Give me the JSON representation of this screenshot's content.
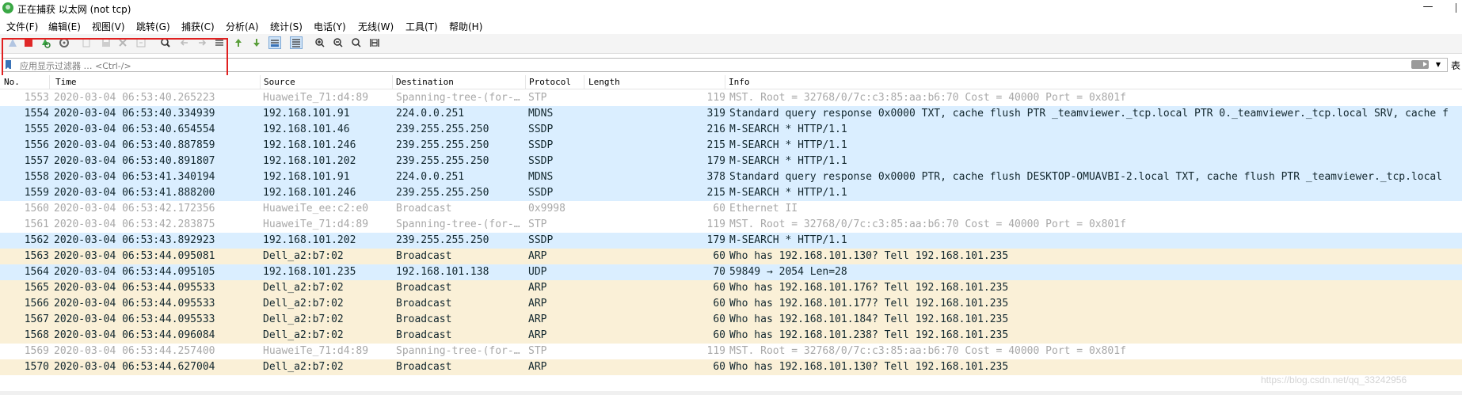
{
  "window": {
    "title": "正在捕获 以太网 (not tcp)",
    "minimize_glyph": "—"
  },
  "menu": [
    "文件(F)",
    "编辑(E)",
    "视图(V)",
    "跳转(G)",
    "捕获(C)",
    "分析(A)",
    "统计(S)",
    "电话(Y)",
    "无线(W)",
    "工具(T)",
    "帮助(H)"
  ],
  "toolbar": {
    "icons": [
      "start-capture-icon",
      "stop-capture-icon",
      "restart-capture-icon",
      "capture-options-icon",
      "open-file-icon",
      "save-file-icon",
      "close-file-icon",
      "reload-file-icon",
      "find-packet-icon",
      "go-back-icon",
      "go-forward-icon",
      "go-to-packet-icon",
      "go-first-icon",
      "go-last-icon",
      "auto-scroll-icon",
      "colorize-icon",
      "zoom-in-icon",
      "zoom-out-icon",
      "normal-size-icon",
      "resize-columns-icon"
    ]
  },
  "filter": {
    "placeholder": "应用显示过滤器 … <Ctrl-/>",
    "right_label": "表"
  },
  "columns": [
    "No.",
    "Time",
    "Source",
    "Destination",
    "Protocol",
    "Length",
    "Info"
  ],
  "packets": [
    {
      "no": "1553",
      "time": "2020-03-04 06:53:40.265223",
      "src": "HuaweiTe_71:d4:89",
      "dst": "Spanning-tree-(for-…",
      "proto": "STP",
      "len": "119",
      "info": "MST. Root = 32768/0/7c:c3:85:aa:b6:70  Cost = 40000  Port = 0x801f",
      "color": "white"
    },
    {
      "no": "1554",
      "time": "2020-03-04 06:53:40.334939",
      "src": "192.168.101.91",
      "dst": "224.0.0.251",
      "proto": "MDNS",
      "len": "319",
      "info": "Standard query response 0x0000 TXT, cache flush PTR _teamviewer._tcp.local PTR 0._teamviewer._tcp.local SRV, cache f",
      "color": "blue"
    },
    {
      "no": "1555",
      "time": "2020-03-04 06:53:40.654554",
      "src": "192.168.101.46",
      "dst": "239.255.255.250",
      "proto": "SSDP",
      "len": "216",
      "info": "M-SEARCH * HTTP/1.1",
      "color": "blue"
    },
    {
      "no": "1556",
      "time": "2020-03-04 06:53:40.887859",
      "src": "192.168.101.246",
      "dst": "239.255.255.250",
      "proto": "SSDP",
      "len": "215",
      "info": "M-SEARCH * HTTP/1.1",
      "color": "blue"
    },
    {
      "no": "1557",
      "time": "2020-03-04 06:53:40.891807",
      "src": "192.168.101.202",
      "dst": "239.255.255.250",
      "proto": "SSDP",
      "len": "179",
      "info": "M-SEARCH * HTTP/1.1",
      "color": "blue"
    },
    {
      "no": "1558",
      "time": "2020-03-04 06:53:41.340194",
      "src": "192.168.101.91",
      "dst": "224.0.0.251",
      "proto": "MDNS",
      "len": "378",
      "info": "Standard query response 0x0000 PTR, cache flush DESKTOP-OMUAVBI-2.local TXT, cache flush PTR _teamviewer._tcp.local",
      "color": "blue"
    },
    {
      "no": "1559",
      "time": "2020-03-04 06:53:41.888200",
      "src": "192.168.101.246",
      "dst": "239.255.255.250",
      "proto": "SSDP",
      "len": "215",
      "info": "M-SEARCH * HTTP/1.1",
      "color": "blue"
    },
    {
      "no": "1560",
      "time": "2020-03-04 06:53:42.172356",
      "src": "HuaweiTe_ee:c2:e0",
      "dst": "Broadcast",
      "proto": "0x9998",
      "len": "60",
      "info": "Ethernet II",
      "color": "white"
    },
    {
      "no": "1561",
      "time": "2020-03-04 06:53:42.283875",
      "src": "HuaweiTe_71:d4:89",
      "dst": "Spanning-tree-(for-…",
      "proto": "STP",
      "len": "119",
      "info": "MST. Root = 32768/0/7c:c3:85:aa:b6:70  Cost = 40000  Port = 0x801f",
      "color": "white"
    },
    {
      "no": "1562",
      "time": "2020-03-04 06:53:43.892923",
      "src": "192.168.101.202",
      "dst": "239.255.255.250",
      "proto": "SSDP",
      "len": "179",
      "info": "M-SEARCH * HTTP/1.1",
      "color": "blue"
    },
    {
      "no": "1563",
      "time": "2020-03-04 06:53:44.095081",
      "src": "Dell_a2:b7:02",
      "dst": "Broadcast",
      "proto": "ARP",
      "len": "60",
      "info": "Who has 192.168.101.130? Tell 192.168.101.235",
      "color": "tan"
    },
    {
      "no": "1564",
      "time": "2020-03-04 06:53:44.095105",
      "src": "192.168.101.235",
      "dst": "192.168.101.138",
      "proto": "UDP",
      "len": "70",
      "info": "59849 → 2054 Len=28",
      "color": "blue"
    },
    {
      "no": "1565",
      "time": "2020-03-04 06:53:44.095533",
      "src": "Dell_a2:b7:02",
      "dst": "Broadcast",
      "proto": "ARP",
      "len": "60",
      "info": "Who has 192.168.101.176? Tell 192.168.101.235",
      "color": "tan"
    },
    {
      "no": "1566",
      "time": "2020-03-04 06:53:44.095533",
      "src": "Dell_a2:b7:02",
      "dst": "Broadcast",
      "proto": "ARP",
      "len": "60",
      "info": "Who has 192.168.101.177? Tell 192.168.101.235",
      "color": "tan"
    },
    {
      "no": "1567",
      "time": "2020-03-04 06:53:44.095533",
      "src": "Dell_a2:b7:02",
      "dst": "Broadcast",
      "proto": "ARP",
      "len": "60",
      "info": "Who has 192.168.101.184? Tell 192.168.101.235",
      "color": "tan"
    },
    {
      "no": "1568",
      "time": "2020-03-04 06:53:44.096084",
      "src": "Dell_a2:b7:02",
      "dst": "Broadcast",
      "proto": "ARP",
      "len": "60",
      "info": "Who has 192.168.101.238? Tell 192.168.101.235",
      "color": "tan"
    },
    {
      "no": "1569",
      "time": "2020-03-04 06:53:44.257400",
      "src": "HuaweiTe_71:d4:89",
      "dst": "Spanning-tree-(for-…",
      "proto": "STP",
      "len": "119",
      "info": "MST. Root = 32768/0/7c:c3:85:aa:b6:70  Cost = 40000  Port = 0x801f",
      "color": "white"
    },
    {
      "no": "1570",
      "time": "2020-03-04 06:53:44.627004",
      "src": "Dell_a2:b7:02",
      "dst": "Broadcast",
      "proto": "ARP",
      "len": "60",
      "info": "Who has 192.168.101.130? Tell 192.168.101.235",
      "color": "tan"
    }
  ],
  "watermark": "https://blog.csdn.net/qq_33242956"
}
